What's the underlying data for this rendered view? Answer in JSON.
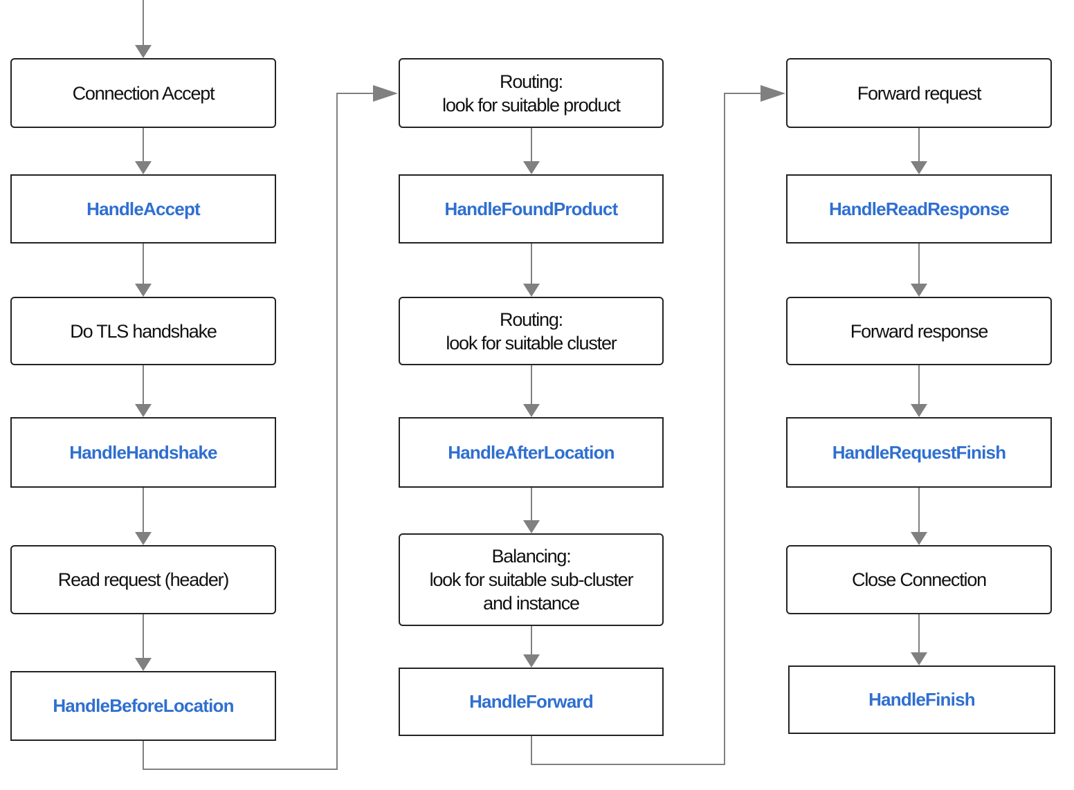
{
  "colors": {
    "hook_text": "#2f6fd0",
    "step_text": "#111111",
    "box_border": "#222222",
    "connector": "#808080"
  },
  "columns": [
    {
      "nodes": [
        {
          "kind": "step",
          "lines": [
            "Connection Accept"
          ]
        },
        {
          "kind": "hook",
          "lines": [
            "HandleAccept"
          ]
        },
        {
          "kind": "step",
          "lines": [
            "Do TLS handshake"
          ]
        },
        {
          "kind": "hook",
          "lines": [
            "HandleHandshake"
          ]
        },
        {
          "kind": "step",
          "lines": [
            "Read request (header)"
          ]
        },
        {
          "kind": "hook",
          "lines": [
            "HandleBeforeLocation"
          ]
        }
      ]
    },
    {
      "nodes": [
        {
          "kind": "step",
          "lines": [
            "Routing:",
            "look for suitable product"
          ]
        },
        {
          "kind": "hook",
          "lines": [
            "HandleFoundProduct"
          ]
        },
        {
          "kind": "step",
          "lines": [
            "Routing:",
            "look for suitable cluster"
          ]
        },
        {
          "kind": "hook",
          "lines": [
            "HandleAfterLocation"
          ]
        },
        {
          "kind": "step",
          "lines": [
            "Balancing:",
            "look for suitable sub-cluster",
            "and instance"
          ]
        },
        {
          "kind": "hook",
          "lines": [
            "HandleForward"
          ]
        }
      ]
    },
    {
      "nodes": [
        {
          "kind": "step",
          "lines": [
            "Forward request"
          ]
        },
        {
          "kind": "hook",
          "lines": [
            "HandleReadResponse"
          ]
        },
        {
          "kind": "step",
          "lines": [
            "Forward response"
          ]
        },
        {
          "kind": "hook",
          "lines": [
            "HandleRequestFinish"
          ]
        },
        {
          "kind": "step",
          "lines": [
            "Close Connection"
          ]
        },
        {
          "kind": "hook",
          "lines": [
            "HandleFinish"
          ]
        }
      ]
    }
  ]
}
